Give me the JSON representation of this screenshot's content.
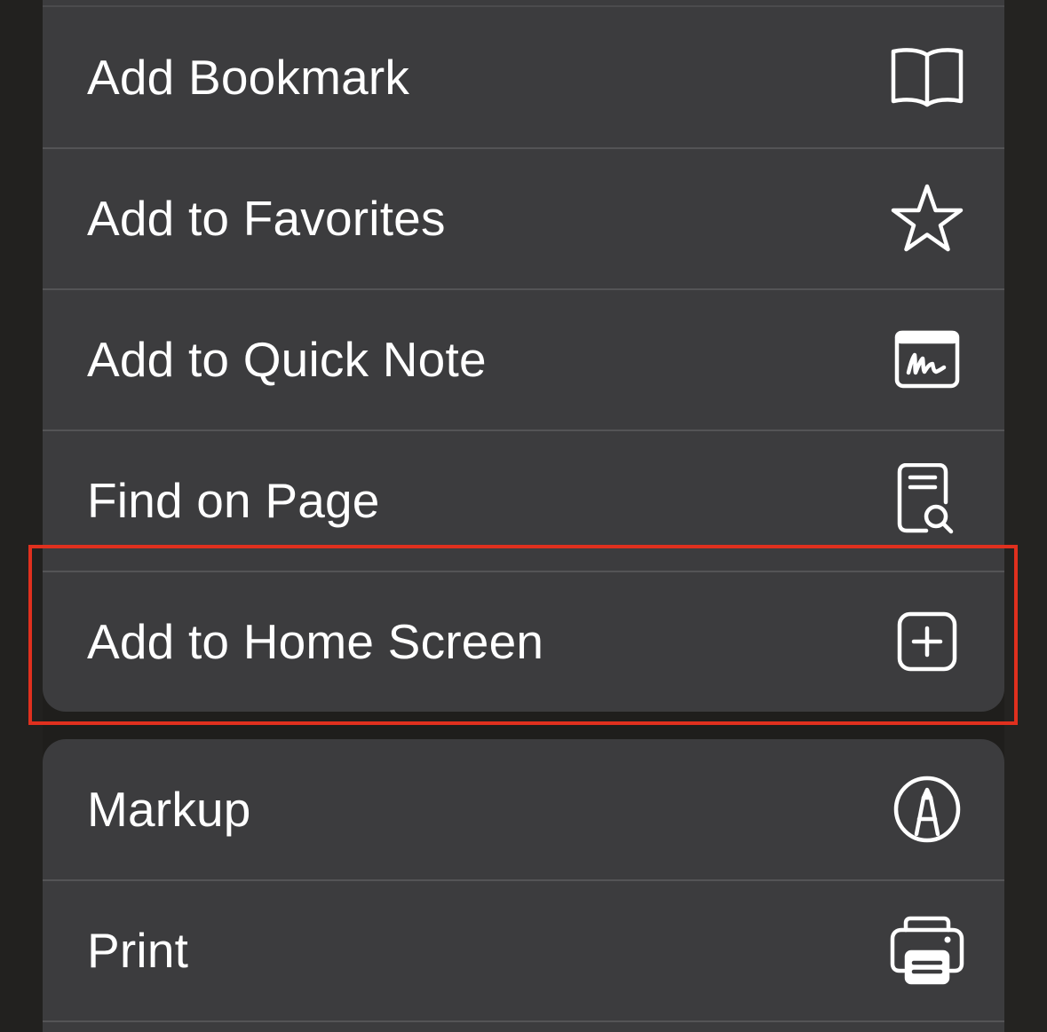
{
  "menu_group_1": {
    "items": [
      {
        "label": "Add Bookmark",
        "icon": "book-icon"
      },
      {
        "label": "Add to Favorites",
        "icon": "star-icon"
      },
      {
        "label": "Add to Quick Note",
        "icon": "quick-note-icon"
      },
      {
        "label": "Find on Page",
        "icon": "find-on-page-icon"
      },
      {
        "label": "Add to Home Screen",
        "icon": "plus-square-icon",
        "highlighted": true
      }
    ]
  },
  "menu_group_2": {
    "items": [
      {
        "label": "Markup",
        "icon": "markup-pen-icon"
      },
      {
        "label": "Print",
        "icon": "printer-icon"
      }
    ]
  },
  "colors": {
    "background": "#1f1e1c",
    "menu_bg": "#3c3c3e",
    "text": "#ffffff",
    "divider": "#545456",
    "highlight": "#e0301e"
  }
}
